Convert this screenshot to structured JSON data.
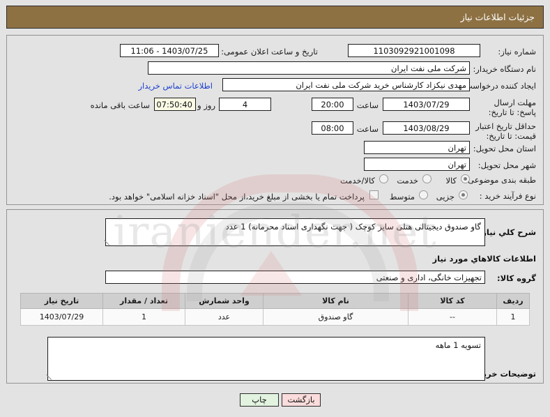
{
  "header": {
    "title": "جزئیات اطلاعات نیاز"
  },
  "watermark": {
    "text": "iraniender.net"
  },
  "top_panel": {
    "need_number": {
      "label": "شماره نیاز:",
      "value": "1103092921001098"
    },
    "public_announce": {
      "label": "تاریخ و ساعت اعلان عمومی:",
      "value": "1403/07/25 - 11:06"
    },
    "buyer_org": {
      "label": "نام دستگاه خریدار:",
      "value": "شرکت ملی نفت ایران"
    },
    "request_creator": {
      "label": "ایجاد کننده درخواست:",
      "value": "مهدی نیکزاد کارشناس خرید شرکت ملی نفت ایران"
    },
    "contact_link": {
      "label": "اطلاعات تماس خریدار"
    },
    "answer_deadline": {
      "label": "مهلت ارسال پاسخ: تا تاریخ:",
      "date": "1403/07/29",
      "hour_label": "ساعت",
      "hour": "20:00",
      "days": "4",
      "days_unit": "روز و",
      "countdown": "07:50:40",
      "countdown_unit": "ساعت باقی مانده"
    },
    "price_validity": {
      "label": "حداقل تاریخ اعتبار قیمت: تا تاریخ:",
      "date": "1403/08/29",
      "hour_label": "ساعت",
      "hour": "08:00"
    },
    "delivery_province": {
      "label": "استان محل تحویل:",
      "value": "تهران"
    },
    "delivery_city": {
      "label": "شهر محل تحویل:",
      "value": "تهران"
    },
    "subject_class": {
      "label": "طبقه بندی موضوعی:",
      "options": [
        "کالا",
        "خدمت",
        "کالا/خدمت"
      ],
      "selected": "کالا"
    },
    "purchase_type": {
      "label": "نوع فرآیند خرید :",
      "options": [
        "جزیی",
        "متوسط"
      ],
      "selected": "جزیی"
    },
    "treasury_note": {
      "label": "پرداخت تمام یا بخشی از مبلغ خرید،از محل \"اسناد خزانه اسلامی\" خواهد بود.",
      "checked": false
    }
  },
  "mid_panel": {
    "need_summary": {
      "label": "شرح کلي نیاز:",
      "value": "گاو صندوق دیجیتالی هتلی سایز کوچک ( جهت نگهداری اسناد محرمانه) 1 عدد"
    },
    "goods_section_title": "اطلاعات كالاهاي مورد نیاز",
    "goods_group": {
      "label": "گروه کالا:",
      "value": "تجهیزات خانگی، اداری و صنعتی"
    },
    "table": {
      "columns": [
        "ردیف",
        "کد کالا",
        "نام کالا",
        "واحد شمارش",
        "تعداد / مقدار",
        "تاریخ نیاز"
      ],
      "rows": [
        [
          "1",
          "--",
          "گاو صندوق",
          "عدد",
          "1",
          "1403/07/29"
        ]
      ]
    },
    "buyer_notes": {
      "label": "توضیحات خریدار:",
      "value": "تسویه 1 ماهه"
    }
  },
  "footer": {
    "print_button": "چاپ",
    "back_button": "بازگشت"
  }
}
